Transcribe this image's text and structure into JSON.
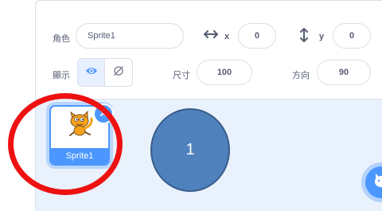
{
  "sprite_info": {
    "name_label": "角色",
    "name_value": "Sprite1",
    "x_label": "x",
    "x_value": "0",
    "y_label": "y",
    "y_value": "0",
    "show_label": "顯示",
    "size_label": "尺寸",
    "size_value": "100",
    "direction_label": "方向",
    "direction_value": "90"
  },
  "sprite_list": {
    "sprites": [
      {
        "name": "Sprite1",
        "selected": true
      }
    ]
  },
  "annotation": {
    "badge_text": "1"
  },
  "icons": {
    "x_axis": "horizontal-arrows-icon",
    "y_axis": "vertical-arrows-icon",
    "show": "eye-icon",
    "hide": "eye-slash-icon",
    "delete": "close-icon",
    "add_sprite": "choose-sprite-icon",
    "sprite_thumb": "scratch-cat-icon"
  },
  "colors": {
    "accent": "#4c97ff",
    "highlight_ring": "#ee1111",
    "badge": "#4f81bd",
    "text": "#575e75",
    "list_bg": "#e9f1fc"
  }
}
